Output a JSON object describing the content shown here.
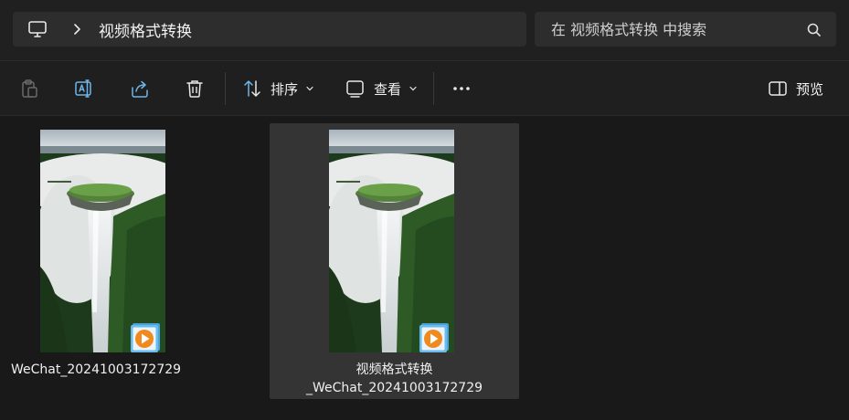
{
  "address": {
    "path_label": "视频格式转换",
    "search_placeholder": "在 视频格式转换 中搜索"
  },
  "toolbar": {
    "sort_label": "排序",
    "view_label": "查看",
    "preview_label": "预览"
  },
  "files": [
    {
      "name_line1": "WeChat_20241003172729",
      "name_line2": "",
      "selected": false
    },
    {
      "name_line1": "视频格式转换",
      "name_line2": "_WeChat_20241003172729",
      "selected": true
    }
  ],
  "colors": {
    "background": "#191919",
    "selection": "#343434",
    "accent_orange": "#f08a1c",
    "accent_blue": "#4aa3df"
  }
}
